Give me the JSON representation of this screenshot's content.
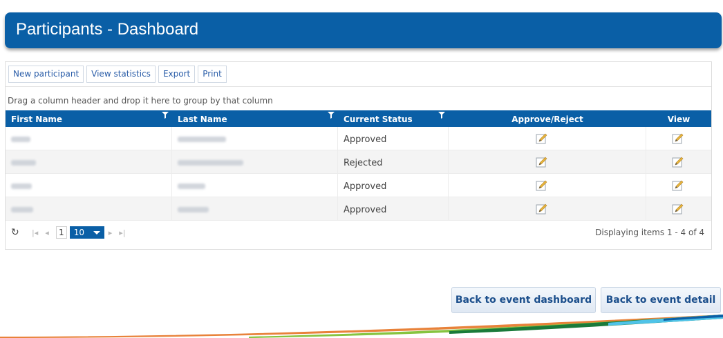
{
  "header": {
    "title": "Participants - Dashboard"
  },
  "toolbar": {
    "new_participant": "New participant",
    "view_statistics": "View statistics",
    "export": "Export",
    "print": "Print"
  },
  "grid": {
    "group_hint": "Drag a column header and drop it here to group by that column",
    "columns": [
      "First Name",
      "Last Name",
      "Current Status",
      "Approve/Reject",
      "View"
    ],
    "rows": [
      {
        "status": "Approved"
      },
      {
        "status": "Rejected"
      },
      {
        "status": "Approved"
      },
      {
        "status": "Approved"
      }
    ]
  },
  "pager": {
    "current_page": "1",
    "page_size": "10",
    "info": "Displaying items 1 - 4 of 4"
  },
  "actions": {
    "back_to_dashboard": "Back to event dashboard",
    "back_to_detail": "Back to event detail"
  },
  "colors": {
    "accent": "#0a5fa6",
    "button_text": "#1c4f8c"
  },
  "icons": [
    "filter-icon",
    "edit-icon",
    "refresh-icon",
    "first-page-icon",
    "prev-page-icon",
    "next-page-icon",
    "last-page-icon",
    "chevron-down-icon"
  ]
}
